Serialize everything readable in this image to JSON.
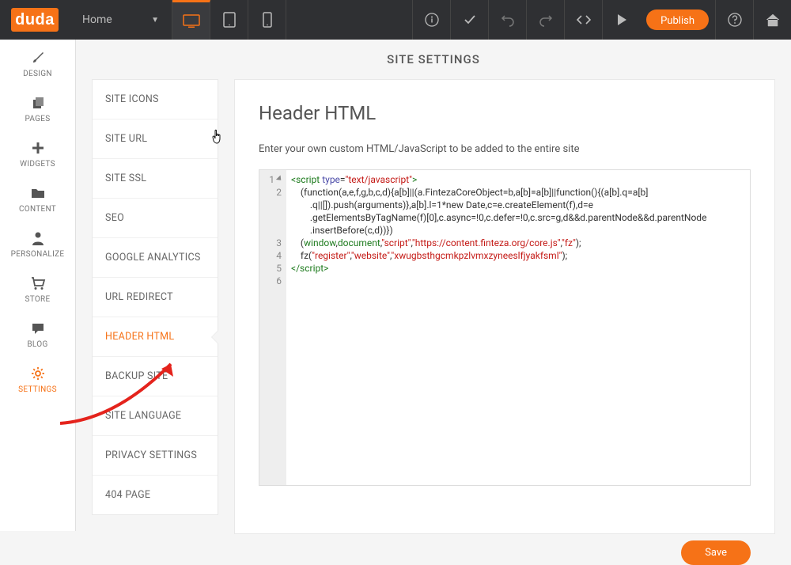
{
  "topbar": {
    "logo": "duda",
    "page_label": "Home",
    "publish_label": "Publish"
  },
  "rail": {
    "items": [
      {
        "label": "DESIGN"
      },
      {
        "label": "PAGES"
      },
      {
        "label": "WIDGETS"
      },
      {
        "label": "CONTENT"
      },
      {
        "label": "PERSONALIZE"
      },
      {
        "label": "STORE"
      },
      {
        "label": "BLOG"
      },
      {
        "label": "SETTINGS"
      }
    ]
  },
  "content_header": "SITE SETTINGS",
  "subnav": {
    "items": [
      {
        "label": "SITE ICONS"
      },
      {
        "label": "SITE URL"
      },
      {
        "label": "SITE SSL"
      },
      {
        "label": "SEO"
      },
      {
        "label": "GOOGLE ANALYTICS"
      },
      {
        "label": "URL REDIRECT"
      },
      {
        "label": "HEADER HTML"
      },
      {
        "label": "BACKUP SITE"
      },
      {
        "label": "SITE LANGUAGE"
      },
      {
        "label": "PRIVACY SETTINGS"
      },
      {
        "label": "404 PAGE"
      }
    ]
  },
  "panel": {
    "title": "Header HTML",
    "desc": "Enter your own custom HTML/JavaScript to be added to the entire site",
    "save_label": "Save"
  },
  "code": {
    "line1a": "<script",
    "line1b": " type",
    "line1c": "=",
    "line1d": "\"text/javascript\"",
    "line1e": ">",
    "line2": "    (function(a,e,f,g,b,c,d){a[b]||(a.FintezaCoreObject=b,a[b]=a[b]||function(){(a[b].q=a[b]\n        .q||[]).push(arguments)},a[b].l=1*new Date,c=e.createElement(f),d=e\n        .getElementsByTagName(f)[0],c.async=!0,c.defer=!0,c.src=g,d&&d.parentNode&&d.parentNode\n        .insertBefore(c,d))})",
    "line3a": "    (",
    "line3b": "window",
    "line3c": ",",
    "line3d": "document",
    "line3e": ",",
    "line3f": "\"script\"",
    "line3g": ",",
    "line3h": "\"https://content.finteza.org/core.js\"",
    "line3i": ",",
    "line3j": "\"fz\"",
    "line3k": ");",
    "line4a": "    fz(",
    "line4b": "\"register\"",
    "line4c": ",",
    "line4d": "\"website\"",
    "line4e": ",",
    "line4f": "\"xwugbsthgcmkpzlvmxzyneeslfjyakfsml\"",
    "line4g": ");",
    "line5": "</script>"
  }
}
